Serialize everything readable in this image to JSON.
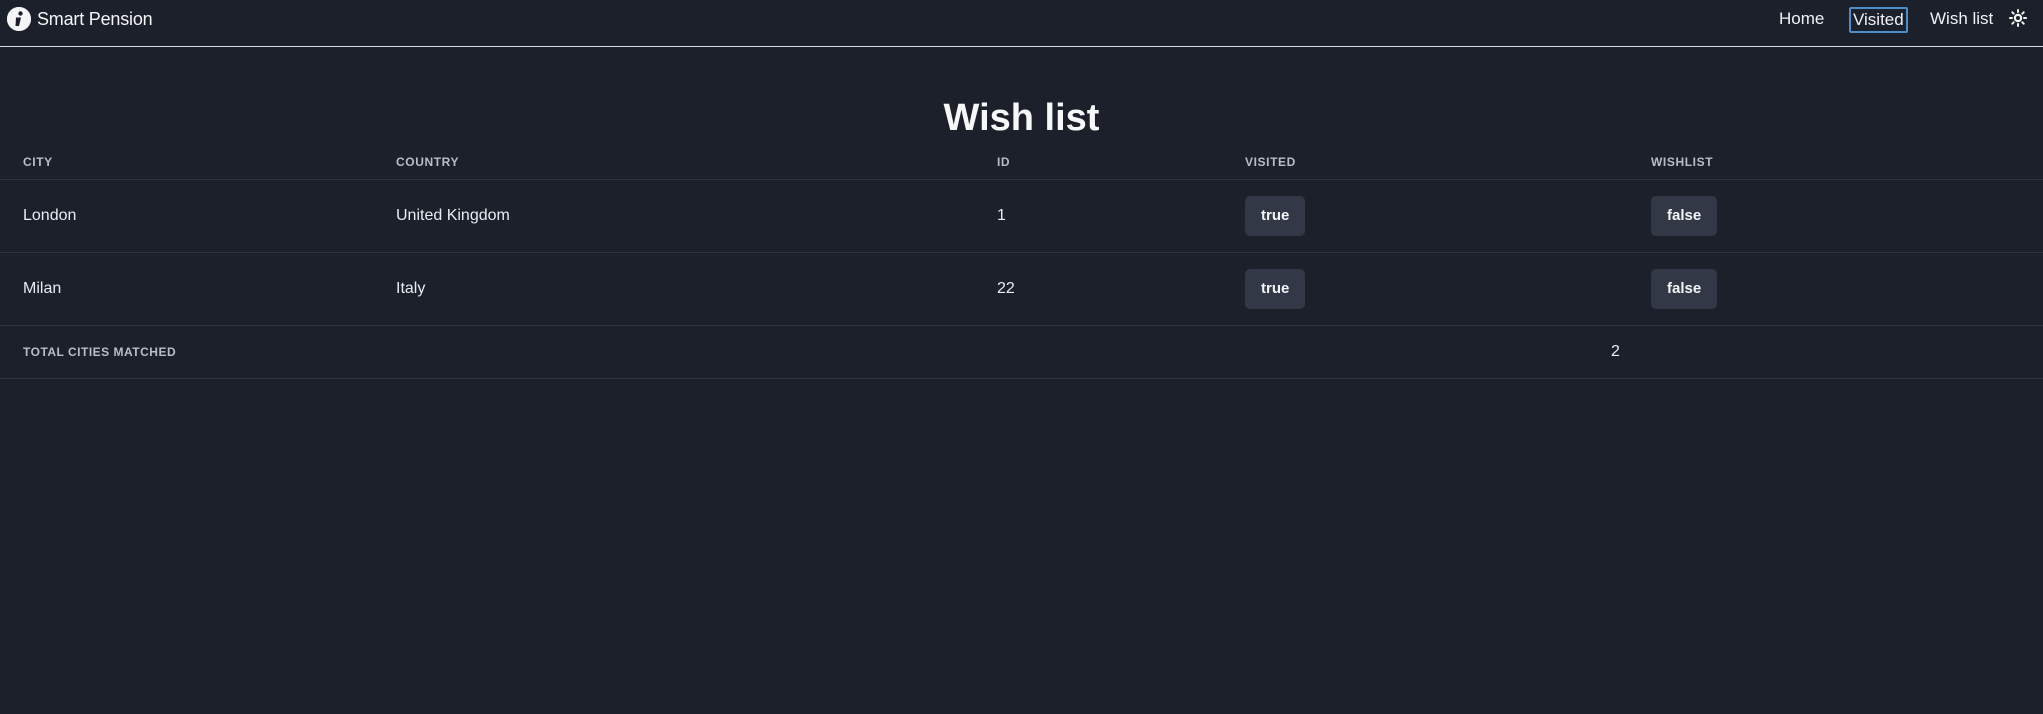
{
  "brand": {
    "name": "Smart Pension",
    "icon": "smart-pension-logo"
  },
  "nav": {
    "home": "Home",
    "visited": "Visited",
    "wishlist": "Wish list",
    "theme_icon": "sun-icon"
  },
  "page": {
    "title": "Wish list"
  },
  "table": {
    "columns": [
      "CITY",
      "COUNTRY",
      "ID",
      "VISITED",
      "WISHLIST"
    ],
    "rows": [
      {
        "city": "London",
        "country": "United Kingdom",
        "id": "1",
        "visited": "true",
        "wishlist": "false"
      },
      {
        "city": "Milan",
        "country": "Italy",
        "id": "22",
        "visited": "true",
        "wishlist": "false"
      }
    ],
    "footer": {
      "label": "TOTAL CITIES MATCHED",
      "value": "2"
    }
  },
  "colors": {
    "background": "#1b202b",
    "pill": "#323846",
    "focus_outline": "#4d8ec8"
  }
}
